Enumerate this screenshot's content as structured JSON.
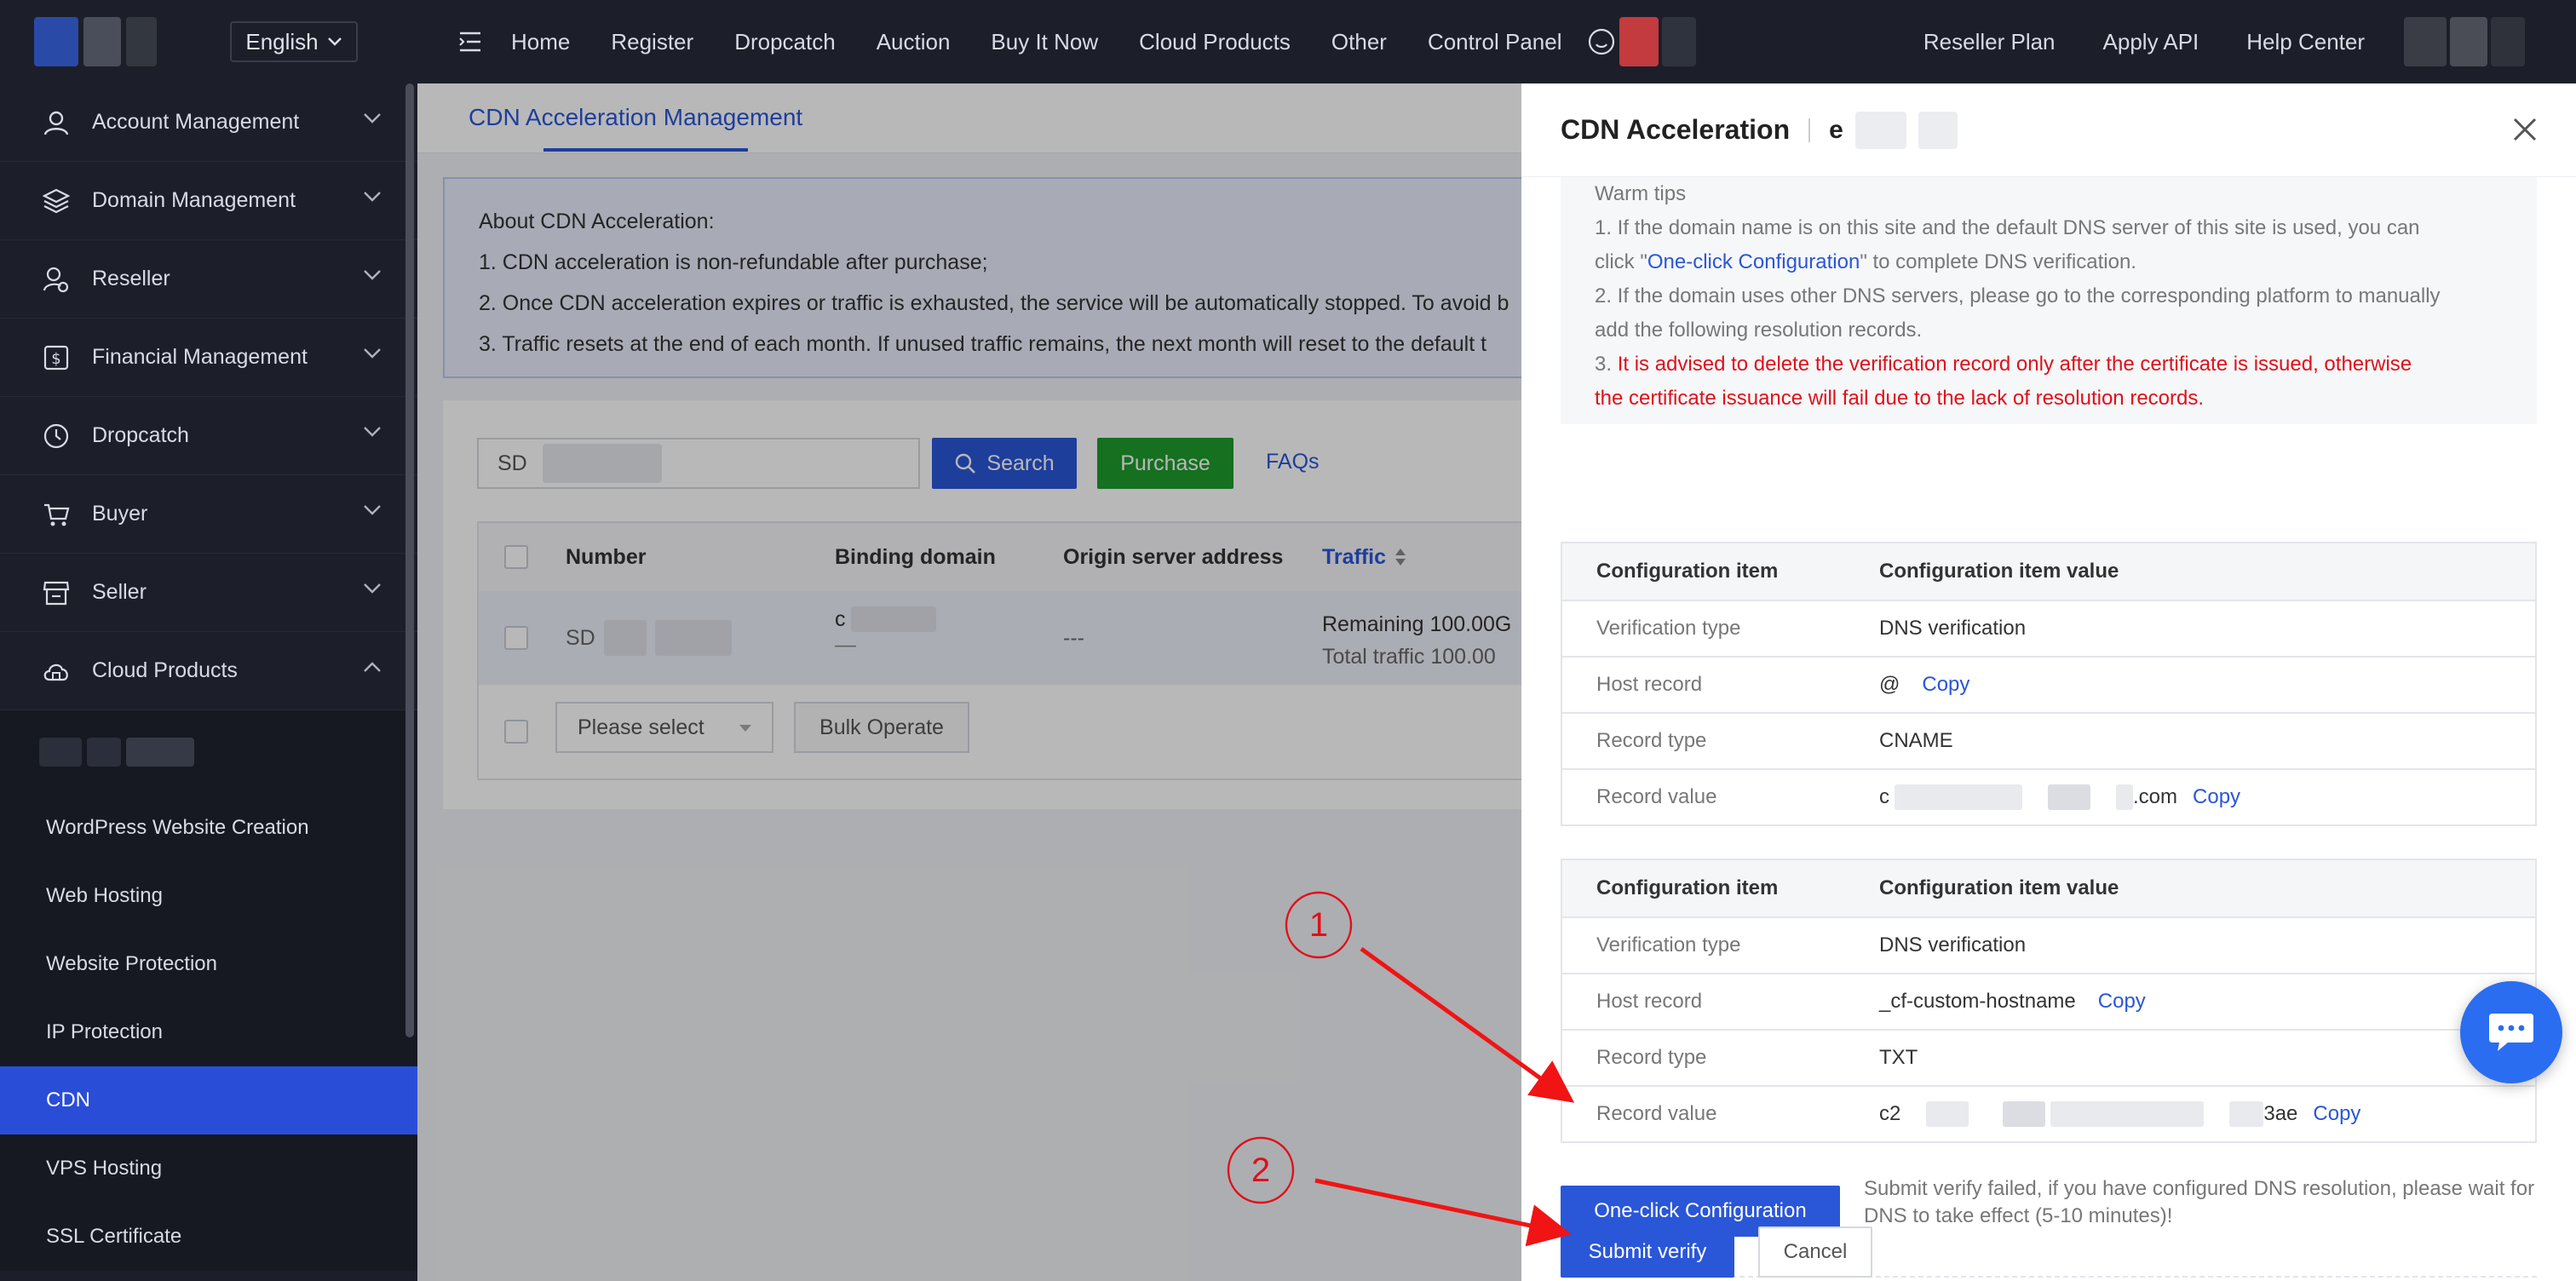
{
  "sidebar": {
    "language": "English",
    "menu": [
      {
        "label": "Account Management",
        "icon": "user-icon"
      },
      {
        "label": "Domain Management",
        "icon": "layers-icon"
      },
      {
        "label": "Reseller",
        "icon": "reseller-icon"
      },
      {
        "label": "Financial Management",
        "icon": "dollar-icon"
      },
      {
        "label": "Dropcatch",
        "icon": "clock-icon"
      },
      {
        "label": "Buyer",
        "icon": "cart-icon"
      },
      {
        "label": "Seller",
        "icon": "store-icon"
      },
      {
        "label": "Cloud Products",
        "icon": "cloud-icon"
      }
    ],
    "submenu": [
      "WordPress Website Creation",
      "Web Hosting",
      "Website Protection",
      "IP Protection",
      "CDN",
      "VPS Hosting",
      "SSL Certificate"
    ]
  },
  "topnav": {
    "items": [
      "Home",
      "Register",
      "Dropcatch",
      "Auction",
      "Buy It Now",
      "Cloud Products",
      "Other",
      "Control Panel"
    ],
    "right": [
      "Reseller Plan",
      "Apply API",
      "Help Center"
    ]
  },
  "main": {
    "tab": "CDN Acceleration Management",
    "notice": {
      "title": "About CDN Acceleration:",
      "lines": [
        "1. CDN acceleration is non-refundable after purchase;",
        "2. Once CDN acceleration expires or traffic is exhausted, the service will be automatically stopped. To avoid b",
        "3. Traffic resets at the end of each month. If unused traffic remains, the next month will reset to the default t"
      ]
    },
    "search_value": "SD",
    "search_button": "Search",
    "purchase_button": "Purchase",
    "faqs_link": "FAQs",
    "table": {
      "headers": [
        "Number",
        "Binding domain",
        "Origin server address",
        "Traffic"
      ],
      "row": {
        "number": "SD",
        "binding_domain": "c",
        "binding_sub": "—",
        "origin": "---",
        "traffic_1": "Remaining 100.00G",
        "traffic_2": "Total traffic 100.00"
      }
    },
    "select_placeholder": "Please select",
    "bulk_button": "Bulk Operate"
  },
  "drawer": {
    "title": "CDN Acceleration",
    "domain_prefix": "e",
    "tips": {
      "heading": "Warm tips",
      "line1a": "1. If the domain name is on this site and the default DNS server of this site is used, you can",
      "line1b_pre": "click \"",
      "line1b_link": "One-click Configuration",
      "line1b_post": "\" to complete DNS verification.",
      "line2a": "2. If the domain uses other DNS servers, please go to the corresponding platform to manually",
      "line2b": "add the following resolution records.",
      "line3a_num": "3. ",
      "line3a": "It is advised to delete the verification record only after the certificate is issued, otherwise",
      "line3b": "the certificate issuance will fail due to the lack of resolution records."
    },
    "table_headers": {
      "key": "Configuration item",
      "value": "Configuration item value"
    },
    "record1": {
      "verification_type_label": "Verification type",
      "verification_type": "DNS verification",
      "host_label": "Host record",
      "host": "@",
      "type_label": "Record type",
      "type": "CNAME",
      "value_label": "Record value",
      "value_start": "c",
      "value_end": ".com"
    },
    "record2": {
      "verification_type_label": "Verification type",
      "verification_type": "DNS verification",
      "host_label": "Host record",
      "host": "_cf-custom-hostname",
      "type_label": "Record type",
      "type": "TXT",
      "value_label": "Record value",
      "value_start": "c2",
      "value_end": "3ae"
    },
    "copy_label": "Copy",
    "oneclick_button": "One-click Configuration",
    "verify_message": "Submit verify failed, if you have configured DNS resolution, please wait for DNS to take effect (5-10 minutes)!",
    "submit_button": "Submit verify",
    "cancel_button": "Cancel"
  },
  "annotations": {
    "step1": "1",
    "step2": "2"
  },
  "colors": {
    "accent": "#2a56d8",
    "success": "#1e9c2d",
    "danger": "#e0101a",
    "sidebar": "#1c1f29",
    "active": "#2a4dd8"
  }
}
